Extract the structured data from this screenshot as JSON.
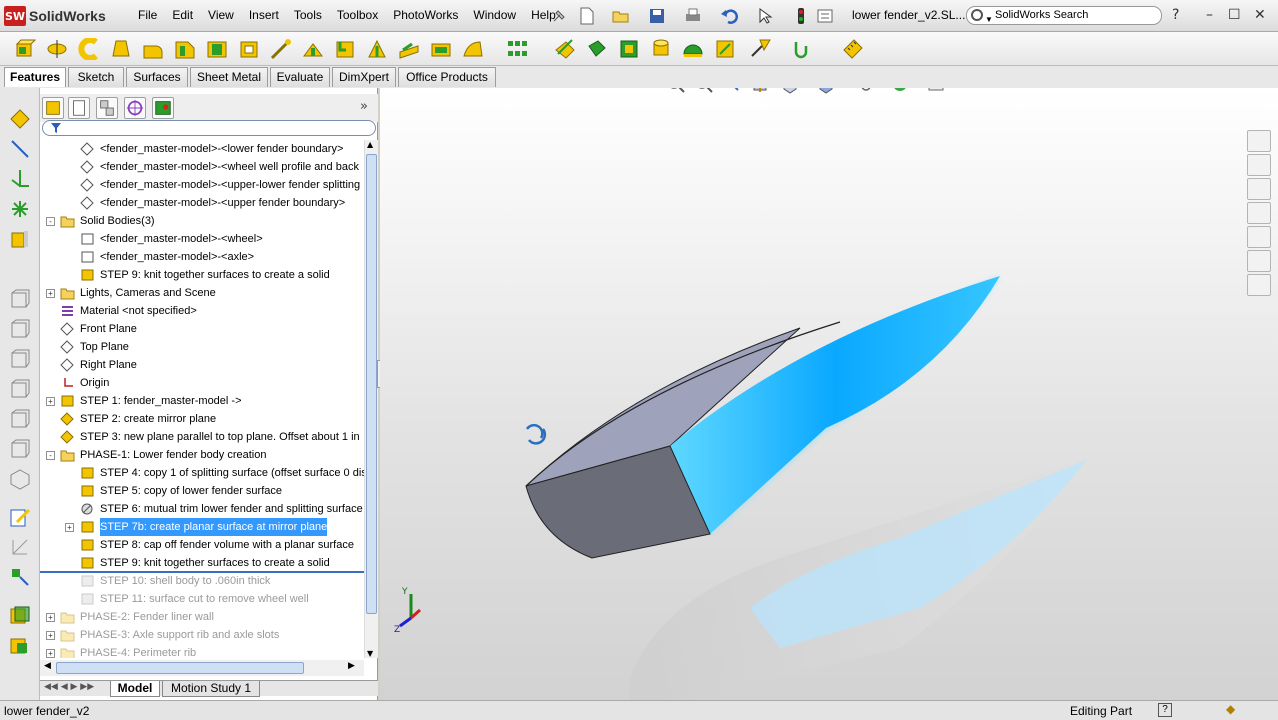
{
  "app": {
    "logo_text": "SolidWorks",
    "badge": "SW"
  },
  "menu": [
    "File",
    "Edit",
    "View",
    "Insert",
    "Tools",
    "Toolbox",
    "PhotoWorks",
    "Window",
    "Help"
  ],
  "document_title": "lower fender_v2.SL...",
  "search": {
    "placeholder": "SolidWorks Search"
  },
  "window_controls": [
    "?",
    "–",
    "☐",
    "✕"
  ],
  "command_tabs": [
    {
      "label": "Features",
      "active": true
    },
    {
      "label": "Sketch",
      "active": false
    },
    {
      "label": "Surfaces",
      "active": false
    },
    {
      "label": "Sheet Metal",
      "active": false
    },
    {
      "label": "Evaluate",
      "active": false
    },
    {
      "label": "DimXpert",
      "active": false
    },
    {
      "label": "Office Products",
      "active": false
    }
  ],
  "tree": [
    {
      "label": "<fender_master-model>-<lower fender boundary>",
      "indent": 2,
      "icon": "sketch-diamond-icon"
    },
    {
      "label": "<fender_master-model>-<wheel well profile and back",
      "indent": 2,
      "icon": "sketch-diamond-icon"
    },
    {
      "label": "<fender_master-model>-<upper-lower fender splitting",
      "indent": 2,
      "icon": "sketch-diamond-icon"
    },
    {
      "label": "<fender_master-model>-<upper fender boundary>",
      "indent": 2,
      "icon": "sketch-diamond-icon"
    },
    {
      "label": "Solid Bodies(3)",
      "indent": 1,
      "expand": "-",
      "icon": "folder-icon"
    },
    {
      "label": "<fender_master-model>-<wheel>",
      "indent": 2,
      "icon": "solid-body-icon"
    },
    {
      "label": "<fender_master-model>-<axle>",
      "indent": 2,
      "icon": "solid-body-icon"
    },
    {
      "label": "STEP 9: knit together surfaces to create a solid",
      "indent": 2,
      "icon": "knit-body-icon"
    },
    {
      "label": "Lights, Cameras and Scene",
      "indent": 1,
      "expand": "+",
      "icon": "lights-folder-icon"
    },
    {
      "label": "Material <not specified>",
      "indent": 1,
      "icon": "material-icon"
    },
    {
      "label": "Front Plane",
      "indent": 1,
      "icon": "plane-icon"
    },
    {
      "label": "Top Plane",
      "indent": 1,
      "icon": "plane-icon"
    },
    {
      "label": "Right Plane",
      "indent": 1,
      "icon": "plane-icon"
    },
    {
      "label": "Origin",
      "indent": 1,
      "icon": "origin-icon"
    },
    {
      "label": "STEP 1: fender_master-model ->",
      "indent": 1,
      "expand": "+",
      "icon": "derived-part-icon"
    },
    {
      "label": "STEP 2: create mirror plane",
      "indent": 1,
      "icon": "plane-feature-icon"
    },
    {
      "label": "STEP 3: new plane parallel to top plane. Offset about 1 in",
      "indent": 1,
      "icon": "plane-feature-icon"
    },
    {
      "label": "PHASE-1: Lower fender body creation",
      "indent": 1,
      "expand": "-",
      "icon": "folder-icon"
    },
    {
      "label": "STEP 4: copy 1 of splitting surface (offset surface 0 dis",
      "indent": 2,
      "icon": "offset-surface-icon"
    },
    {
      "label": "STEP 5: copy of lower fender surface",
      "indent": 2,
      "icon": "offset-surface-icon"
    },
    {
      "label": "STEP 6: mutual trim lower fender and splitting surface",
      "indent": 2,
      "icon": "trim-surface-icon"
    },
    {
      "label": "STEP 7b: create planar surface at mirror plane",
      "indent": 2,
      "expand": "+",
      "icon": "planar-surface-icon",
      "selected": true
    },
    {
      "label": "STEP 8: cap off fender volume with a planar surface",
      "indent": 2,
      "icon": "planar-surface-icon"
    },
    {
      "label": "STEP 9: knit together surfaces to create a solid",
      "indent": 2,
      "icon": "knit-surface-icon"
    },
    {
      "label": "STEP 10: shell body to .060in thick",
      "indent": 2,
      "icon": "shell-icon",
      "suppressed": true
    },
    {
      "label": "STEP 11: surface cut to remove wheel well",
      "indent": 2,
      "icon": "surface-cut-icon",
      "suppressed": true
    },
    {
      "label": "PHASE-2: Fender liner wall",
      "indent": 1,
      "expand": "+",
      "icon": "folder-icon",
      "suppressed": true
    },
    {
      "label": "PHASE-3: Axle support rib and axle slots",
      "indent": 1,
      "expand": "+",
      "icon": "folder-icon",
      "suppressed": true
    },
    {
      "label": "PHASE-4: Perimeter rib",
      "indent": 1,
      "expand": "+",
      "icon": "folder-icon",
      "suppressed": true
    }
  ],
  "bottom_tabs": [
    {
      "label": "Model",
      "active": true
    },
    {
      "label": "Motion Study 1",
      "active": false
    }
  ],
  "triad": {
    "y_label": "Y",
    "x_label": "X",
    "z_label": "Z"
  },
  "status": {
    "left": "lower fender_v2",
    "right": "Editing Part"
  },
  "colors": {
    "accent_blue": "#3399ff",
    "surface_cyan": "#1ea8ff",
    "body_grey": "#6a6d78",
    "top_face": "#a0a2b8"
  }
}
